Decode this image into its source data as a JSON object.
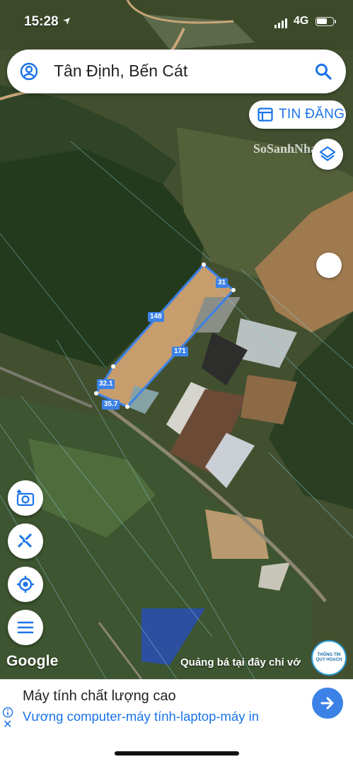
{
  "status_bar": {
    "time": "15:28",
    "network": "4G"
  },
  "search": {
    "query": "Tân Định, Bến Cát"
  },
  "post_button": {
    "label": "TIN ĐĂNG"
  },
  "watermark": "SoSanhNha",
  "measurements": {
    "north_west": "148",
    "north_east": "31",
    "south_east": "171",
    "south_west": "35.7",
    "west": "32.1"
  },
  "map_footer": {
    "google": "Google",
    "promo": "Quảng bá tại đây chỉ vớ",
    "planning_badge": "THÔNG TIN QUY HOẠCH"
  },
  "ad": {
    "title": "Máy tính chất lượng cao",
    "subtitle": "Vương computer-máy tính-laptop-máy in"
  },
  "icons": [
    "account-icon",
    "search-icon",
    "post-listing-icon",
    "layers-icon",
    "add-photo-icon",
    "measure-icon",
    "my-location-icon",
    "menu-icon",
    "arrow-right-icon",
    "info-icon",
    "close-icon"
  ],
  "colors": {
    "accent": "#1a73e8",
    "measure": "#3c82e6"
  }
}
